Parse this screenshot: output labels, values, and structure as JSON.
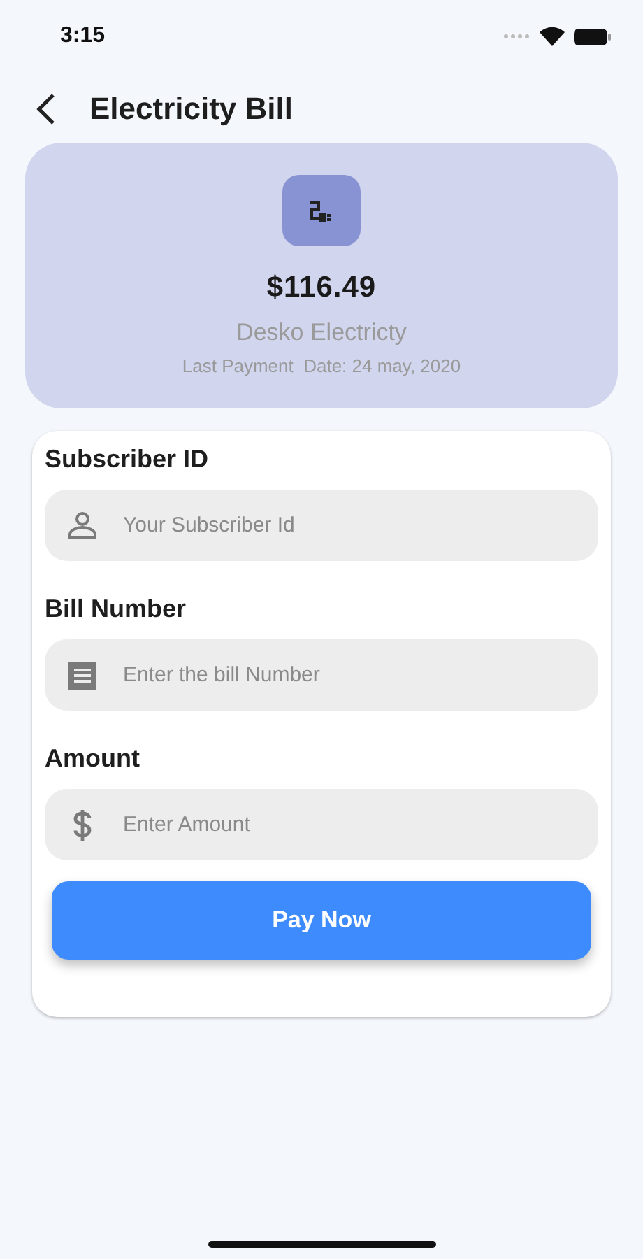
{
  "status_bar": {
    "time": "3:15"
  },
  "header": {
    "title": "Electricity Bill"
  },
  "bill": {
    "amount": "$116.49",
    "provider": "Desko Electricty",
    "last_payment": "Last Payment  Date: 24 may, 2020"
  },
  "fields": [
    {
      "label": "Subscriber ID",
      "placeholder": "Your Subscriber Id",
      "kind": "person"
    },
    {
      "label": "Bill Number",
      "placeholder": "Enter the bill Number",
      "kind": "receipt"
    },
    {
      "label": "Amount",
      "placeholder": "Enter Amount",
      "kind": "dollar"
    }
  ],
  "button": "Pay Now"
}
